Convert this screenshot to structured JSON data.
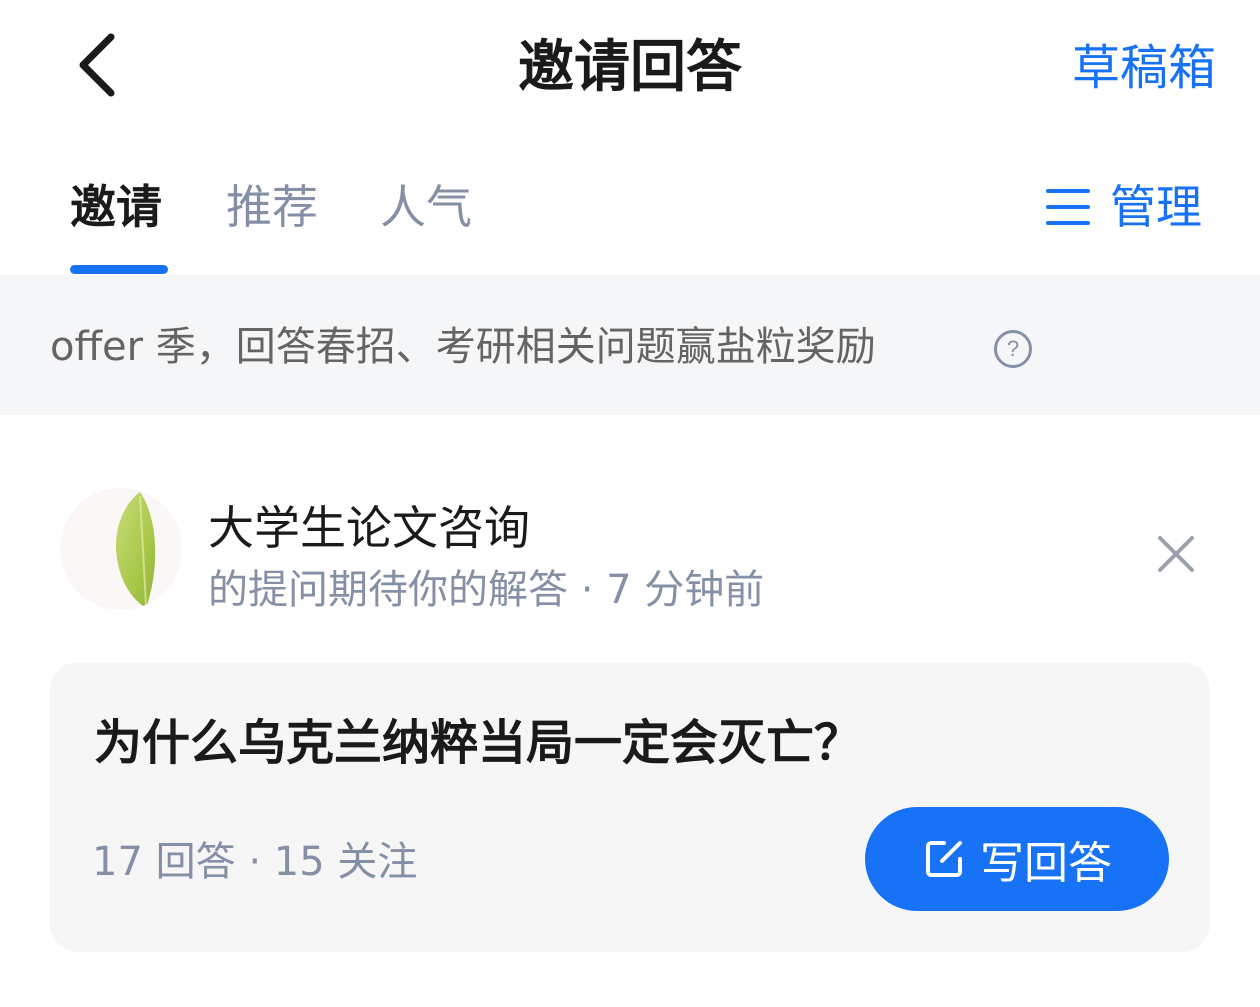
{
  "header": {
    "title": "邀请回答",
    "drafts_label": "草稿箱",
    "back_icon": "chevron-left-icon"
  },
  "tabs": {
    "items": [
      {
        "label": "邀请",
        "active": true
      },
      {
        "label": "推荐",
        "active": false
      },
      {
        "label": "人气",
        "active": false
      }
    ],
    "manage_label": "管理",
    "manage_icon": "menu-lines-icon",
    "accent_color": "#1772f6"
  },
  "promo": {
    "text": "offer 季，回答春招、考研相关问题赢盐粒奖励",
    "help_icon_glyph": "?"
  },
  "invitation": {
    "asker_name": "大学生论文咨询",
    "subtitle": "的提问期待你的解答 · 7 分钟前",
    "close_icon": "close-icon"
  },
  "question": {
    "title": "为什么乌克兰纳粹当局一定会灭亡？",
    "stats": "17 回答 · 15 关注",
    "answer_button_label": "写回答",
    "answer_icon": "edit-icon"
  }
}
